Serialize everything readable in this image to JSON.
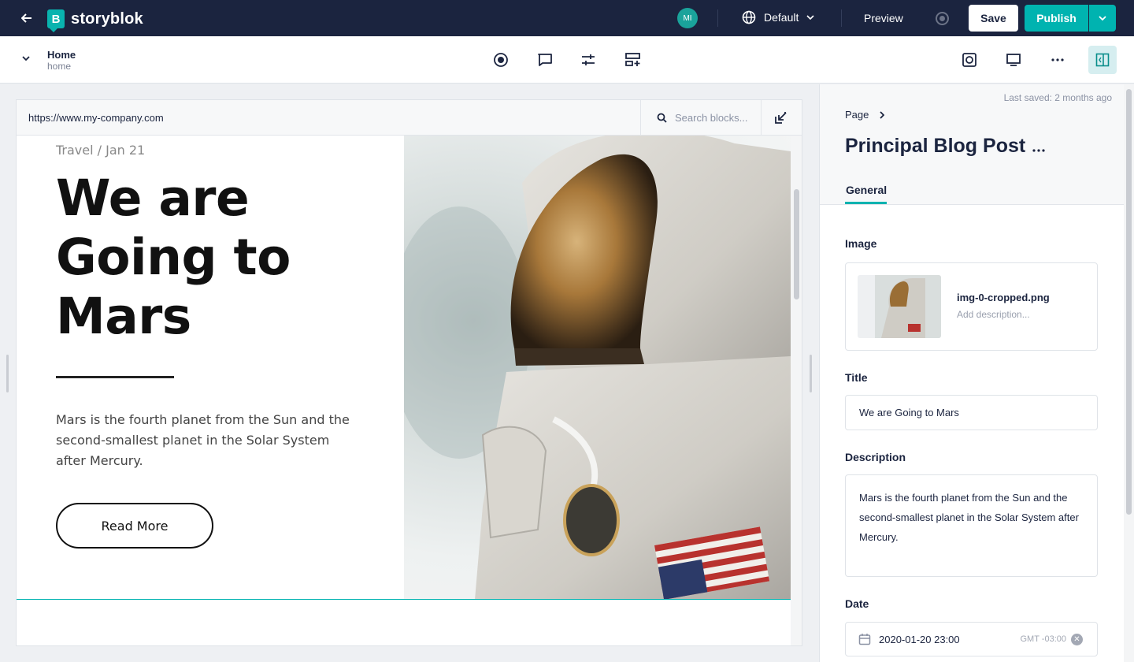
{
  "topbar": {
    "brand": "storyblok",
    "avatar_initials": "MI",
    "language": "Default",
    "preview_label": "Preview",
    "save_label": "Save",
    "publish_label": "Publish",
    "icons": [
      "arrow-left-icon",
      "globe-icon",
      "chevron-down-icon",
      "record-icon",
      "chevron-down-icon"
    ]
  },
  "story": {
    "name": "Home",
    "slug": "home"
  },
  "toolbar": {
    "icons": [
      "target-icon",
      "comment-icon",
      "sliders-icon",
      "add-block-icon",
      "screenshot-icon",
      "desktop-icon",
      "more-icon",
      "panel-toggle-icon"
    ]
  },
  "preview": {
    "url": "https://www.my-company.com",
    "search_placeholder": "Search blocks...",
    "hero": {
      "meta": "Travel / Jan 21",
      "title": "We are Going to Mars",
      "description": "Mars is the fourth planet from the Sun and the second-smallest planet in the Solar System after Mercury.",
      "button": "Read More"
    }
  },
  "panel": {
    "last_saved": "Last saved: 2 months ago",
    "breadcrumb": "Page",
    "component_title": "Principal Blog Post",
    "tab": "General",
    "fields": {
      "image_label": "Image",
      "image_filename": "img-0-cropped.png",
      "image_description_placeholder": "Add description...",
      "title_label": "Title",
      "title_value": "We are Going to Mars",
      "description_label": "Description",
      "description_value": "Mars is the fourth planet from the Sun and the second-smallest planet in the Solar System after Mercury.",
      "date_label": "Date",
      "date_value": "2020-01-20 23:00",
      "timezone": "GMT -03:00"
    }
  },
  "colors": {
    "topbar": "#1b243f",
    "accent": "#00b3b0"
  }
}
